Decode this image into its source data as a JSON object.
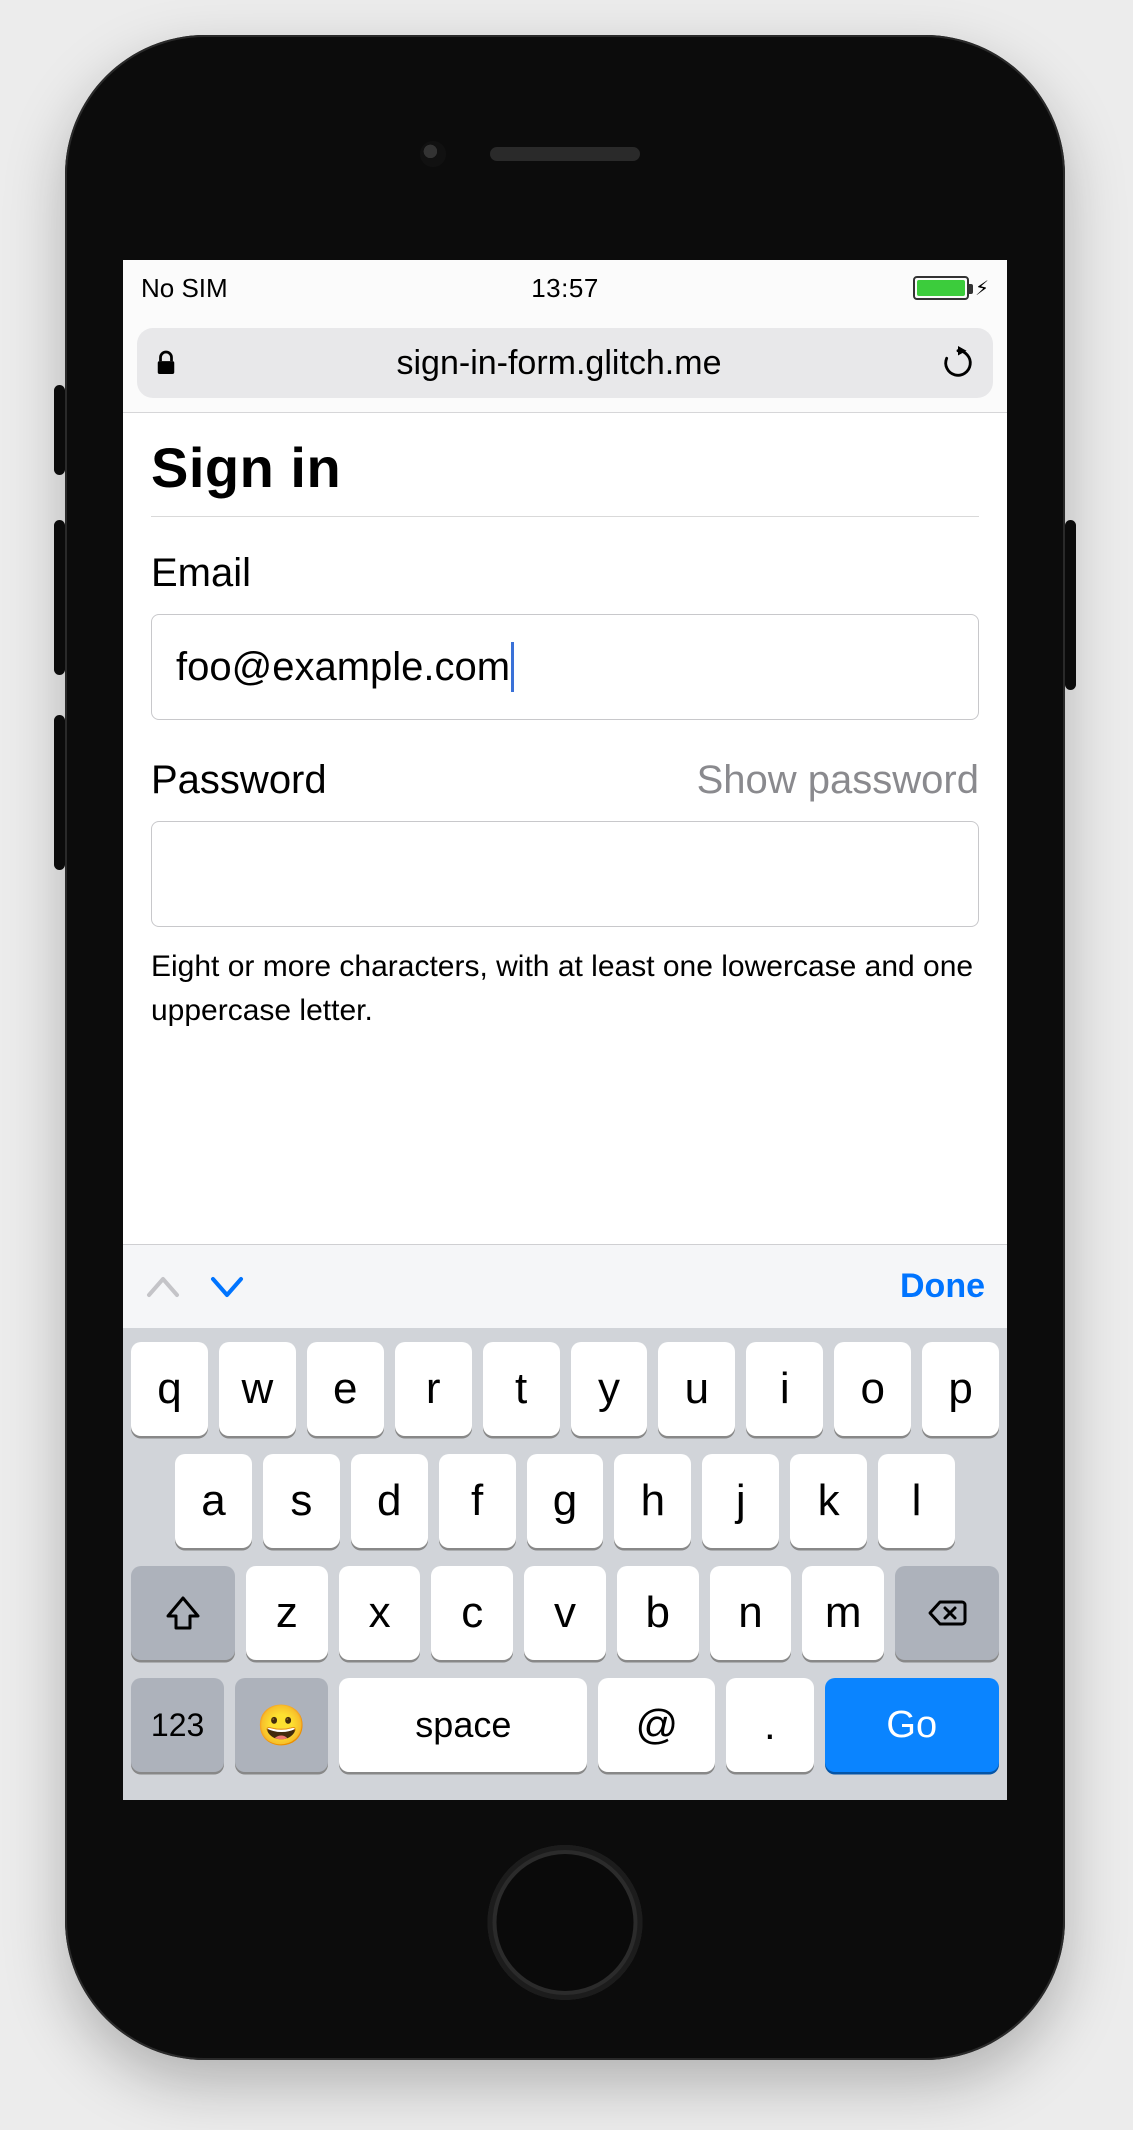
{
  "status": {
    "carrier": "No SIM",
    "time": "13:57"
  },
  "browser": {
    "url": "sign-in-form.glitch.me"
  },
  "page": {
    "title": "Sign in",
    "email_label": "Email",
    "email_value": "foo@example.com",
    "password_label": "Password",
    "show_password_label": "Show password",
    "password_value": "",
    "password_hint": "Eight or more characters, with at least one lowercase and one uppercase letter."
  },
  "kb_accessory": {
    "done_label": "Done"
  },
  "keyboard": {
    "row1": [
      "q",
      "w",
      "e",
      "r",
      "t",
      "y",
      "u",
      "i",
      "o",
      "p"
    ],
    "row2": [
      "a",
      "s",
      "d",
      "f",
      "g",
      "h",
      "j",
      "k",
      "l"
    ],
    "row3": [
      "z",
      "x",
      "c",
      "v",
      "b",
      "n",
      "m"
    ],
    "numkey": "123",
    "emoji": "😀",
    "space": "space",
    "at": "@",
    "dot": ".",
    "go": "Go"
  }
}
